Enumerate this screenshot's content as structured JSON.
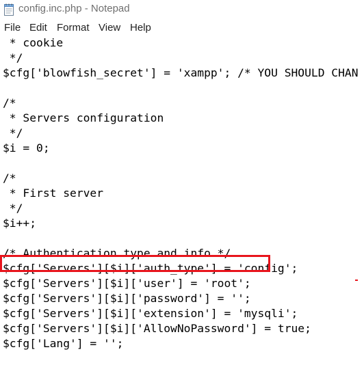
{
  "window": {
    "title": "config.inc.php - Notepad",
    "app_icon": "notepad-icon"
  },
  "menu": {
    "items": [
      "File",
      "Edit",
      "Format",
      "View",
      "Help"
    ]
  },
  "editor": {
    "lines": [
      " * cookie",
      " */",
      "$cfg['blowfish_secret'] = 'xampp'; /* YOU SHOULD CHAN",
      "",
      "/*",
      " * Servers configuration",
      " */",
      "$i = 0;",
      "",
      "/*",
      " * First server",
      " */",
      "$i++;",
      "",
      "/* Authentication type and info */",
      "$cfg['Servers'][$i]['auth_type'] = 'config';",
      "$cfg['Servers'][$i]['user'] = 'root';",
      "$cfg['Servers'][$i]['password'] = '';",
      "$cfg['Servers'][$i]['extension'] = 'mysqli';",
      "$cfg['Servers'][$i]['AllowNoPassword'] = true;",
      "$cfg['Lang'] = '';"
    ],
    "highlighted_line": 17,
    "highlight_color": "#e8141c"
  }
}
